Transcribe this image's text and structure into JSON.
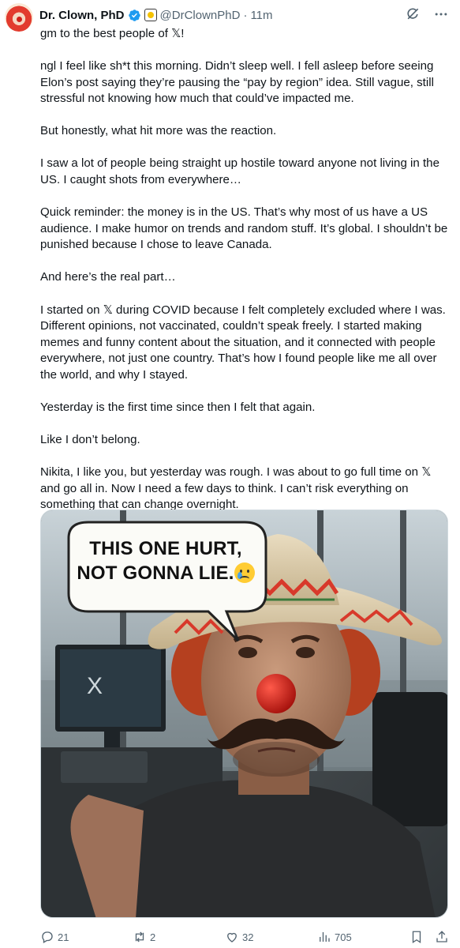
{
  "author": {
    "name": "Dr. Clown, PhD",
    "handle": "@DrClownPhD",
    "separator": "·",
    "time": "11m"
  },
  "icons": {
    "verified": "verified-badge-icon",
    "affiliation": "affiliation-badge-icon",
    "grok": "grok-icon",
    "more": "more-icon",
    "reply": "reply-icon",
    "retweet": "retweet-icon",
    "like": "like-icon",
    "views": "views-icon",
    "bookmark": "bookmark-icon",
    "share": "share-icon"
  },
  "colors": {
    "verified_blue": "#1d9bf0",
    "text_primary": "#0f1419",
    "text_secondary": "#536471"
  },
  "post": {
    "paragraphs": [
      "gm to the best people of 𝕏!",
      "ngl I feel like sh*t this morning. Didn’t sleep well. I fell asleep before seeing Elon’s post saying they’re pausing the “pay by region” idea. Still vague, still stressful not knowing how much that could’ve impacted me.",
      "But honestly, what hit more was the reaction.",
      "I saw a lot of people being straight up hostile toward anyone not living in the US. I caught shots from everywhere…",
      "Quick reminder: the money is in the US. That’s why most of us have a US audience. I make humor on trends and random stuff. It’s global. I shouldn’t be punished because I chose to leave Canada.",
      "And here’s the real part…",
      "I started on 𝕏 during COVID because I felt completely excluded where I was. Different opinions, not vaccinated, couldn’t speak freely. I started making memes and funny content about the situation, and it connected with people everywhere, not just one country. That’s how I found people like me all over the world, and why I stayed.",
      "Yesterday is the first time since then I felt that again.",
      "Like I don’t belong.",
      "Nikita, I like you, but yesterday was rough. I was about to go full time on 𝕏 and go all in. Now I need a few days to think. I can’t risk everything on something that can change overnight."
    ]
  },
  "media": {
    "bubble_line1": "THIS ONE HURT,",
    "bubble_line2": "NOT GONNA LIE.",
    "monitor_letter": "X"
  },
  "stats": {
    "replies": "21",
    "retweets": "2",
    "likes": "32",
    "views": "705"
  }
}
